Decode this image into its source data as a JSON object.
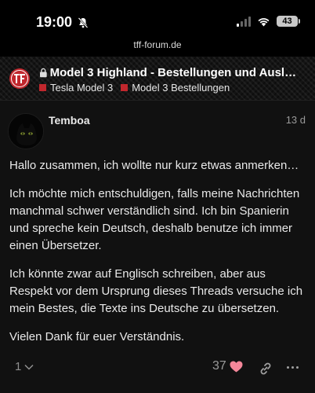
{
  "status_bar": {
    "time": "19:00",
    "battery": "43"
  },
  "browser": {
    "url": "tff-forum.de"
  },
  "topic": {
    "title": "Model 3 Highland - Bestellungen und Auslie…",
    "categories": [
      "Tesla Model 3",
      "Model 3 Bestellungen"
    ],
    "category_color": "#c1272d"
  },
  "post": {
    "username": "Temboa",
    "age": "13 d",
    "paragraphs": [
      "Hallo zusammen, ich wollte nur kurz etwas anmerken…",
      "Ich möchte mich entschuldigen, falls meine Nachrichten manchmal schwer verständlich sind. Ich bin Spanierin und spreche kein Deutsch, deshalb benutze ich immer einen Übersetzer.",
      "Ich könnte zwar auf Englisch schreiben, aber aus Respekt vor dem Ursprung dieses Threads versuche ich mein Bestes, die Texte ins Deutsche zu übersetzen.",
      "Vielen Dank für euer Verständnis."
    ],
    "reply_count": "1",
    "like_count": "37",
    "like_color": "#f4879a"
  },
  "icons": [
    "bell-slash-icon",
    "signal-icon",
    "wifi-icon",
    "battery-icon",
    "lock-icon",
    "logo",
    "chevron-down-icon",
    "heart-icon",
    "link-icon",
    "more-icon"
  ]
}
